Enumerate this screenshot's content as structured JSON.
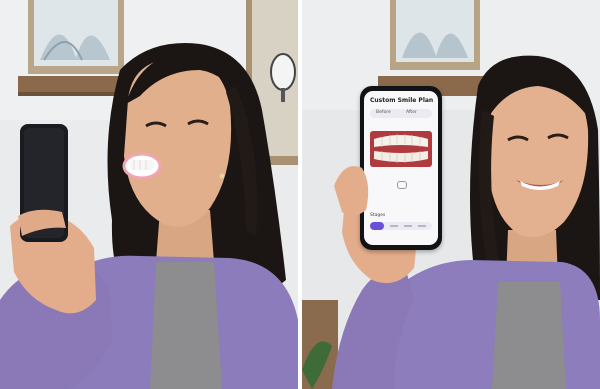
{
  "scene": {
    "left_panel": {
      "subject": "woman-holding-phone-camera"
    },
    "right_panel": {
      "subject": "woman-showing-phone-screen"
    }
  },
  "phone_screen": {
    "title": "Custom Smile Plan",
    "tab_before": "Before",
    "tab_after": "After",
    "section_label": "Stages",
    "icon": "teeth-aligner-icon"
  },
  "colors": {
    "wall": "#e7eaec",
    "sweater": "#8b7bb8",
    "hair": "#1b1614",
    "skin": "#e3b08e",
    "accent_purple": "#6a4fd8"
  }
}
